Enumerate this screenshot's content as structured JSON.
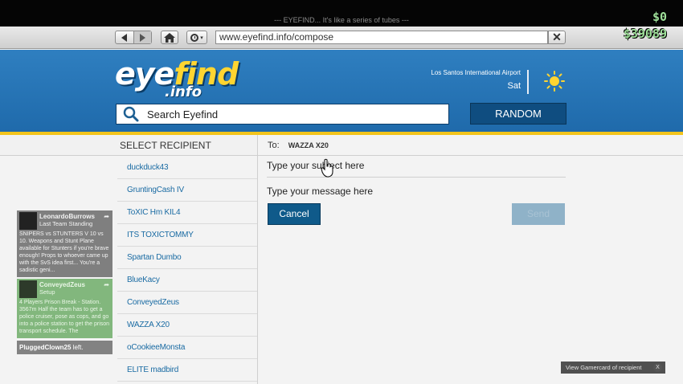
{
  "window": {
    "title": "--- EYEFIND... It's like a series of tubes ---"
  },
  "hud": {
    "cash": "$0",
    "bank": "$39089"
  },
  "browser": {
    "url": "www.eyefind.info/compose",
    "close_label": "✕"
  },
  "header": {
    "logo_eye": "eye",
    "logo_find": "find",
    "logo_info": ".info",
    "location": "Los Santos International Airport",
    "day": "Sat",
    "search_placeholder": "Search Eyefind",
    "random_label": "RANDOM",
    "weather_icon": "sun-icon"
  },
  "recipients": {
    "header": "SELECT RECIPIENT",
    "items": [
      "duckduck43",
      "GruntingCash IV",
      "ToXIC Hm KIL4",
      "ITS TOXICTOMMY",
      "Spartan Dumbo",
      "BlueKacy",
      "ConveyedZeus",
      "WAZZA X20",
      "oCookieeMonsta",
      "ELITE madbird"
    ]
  },
  "compose": {
    "to_label": "To:",
    "to_value": "WAZZA X20",
    "subject_placeholder": "Type your subject here",
    "message_placeholder": "Type your message here",
    "cancel_label": "Cancel",
    "send_label": "Send"
  },
  "feed": {
    "cards": [
      {
        "player": "LeonardoBurrows",
        "mode": "Last Team Standing",
        "text": "SNIPERS vs STUNTERS V 10 vs 10. Weapons and Stunt Plane available for Stunters if you're brave enough! Props to whoever came up with the SvS idea first... You're a sadistic geni..."
      },
      {
        "player": "ConveyedZeus",
        "mode": "Setup",
        "text": "4 Players Prison Break - Station. 3567m Half the team has to get a police cruiser, pose as cops, and go into a police station to get the prison transport schedule. The"
      }
    ],
    "join_player": "PluggedClown25",
    "join_text": "left."
  },
  "gamercard": {
    "label": "View Gamercard of recipient",
    "button": "X"
  }
}
